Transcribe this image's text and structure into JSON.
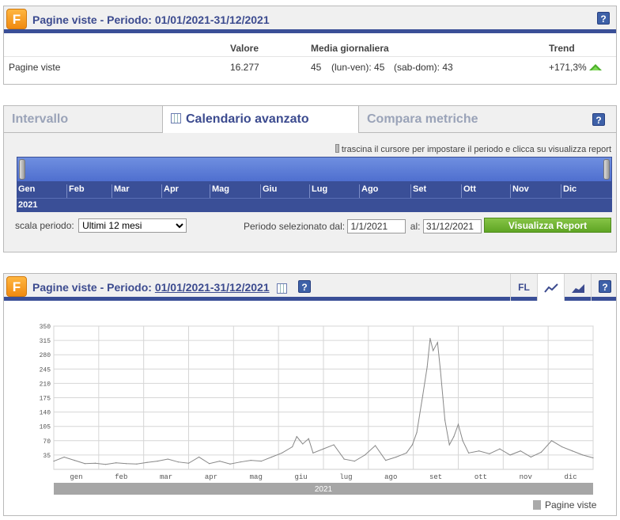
{
  "summary": {
    "logo": "F",
    "title": "Pagine viste - Periodo: 01/01/2021-31/12/2021",
    "help": "?",
    "headers": {
      "valore": "Valore",
      "media": "Media giornaliera",
      "trend": "Trend"
    },
    "row": {
      "label": "Pagine viste",
      "valore": "16.277",
      "media": "45",
      "lunven": "(lun-ven): 45",
      "sabdom": "(sab-dom): 43",
      "trend": "+171,3%"
    }
  },
  "calendar": {
    "tabs": [
      "Intervallo",
      "Calendario avanzato",
      "Compara metriche"
    ],
    "active_tab": 1,
    "help": "?",
    "hint": "trascina il cursore per impostare il periodo e clicca su visualizza report",
    "months": [
      "Gen",
      "Feb",
      "Mar",
      "Apr",
      "Mag",
      "Giu",
      "Lug",
      "Ago",
      "Set",
      "Ott",
      "Nov",
      "Dic"
    ],
    "year": "2021",
    "scale_label": "scala periodo:",
    "scale_value": "Ultimi 12 mesi",
    "period_label": "Periodo selezionato dal:",
    "from": "1/1/2021",
    "to_label": "al:",
    "to": "31/12/2021",
    "button": "Visualizza Report"
  },
  "chart_panel": {
    "logo": "F",
    "title_prefix": "Pagine viste - Periodo:",
    "title_period": "01/01/2021-31/12/2021",
    "help": "?",
    "fl": "FL",
    "accent": "#3a4f97"
  },
  "chart_data": {
    "type": "line",
    "ylim": [
      0,
      350
    ],
    "yticks": [
      35,
      70,
      105,
      140,
      175,
      210,
      245,
      280,
      315,
      350
    ],
    "categories": [
      "gen",
      "feb",
      "mar",
      "apr",
      "mag",
      "giu",
      "lug",
      "ago",
      "set",
      "ott",
      "nov",
      "dic"
    ],
    "year_label": "2021",
    "series": [
      {
        "name": "Pagine viste",
        "color": "#888888",
        "x": [
          1,
          8,
          15,
          22,
          29,
          36,
          43,
          50,
          57,
          64,
          71,
          78,
          85,
          92,
          99,
          106,
          113,
          120,
          127,
          134,
          141,
          148,
          155,
          162,
          165,
          169,
          173,
          176,
          183,
          190,
          197,
          204,
          211,
          218,
          225,
          232,
          239,
          243,
          246,
          250,
          253,
          255,
          257,
          260,
          262,
          265,
          268,
          271,
          274,
          277,
          281,
          288,
          295,
          302,
          309,
          316,
          323,
          330,
          337,
          344,
          351,
          358,
          365
        ],
        "values": [
          20,
          30,
          22,
          14,
          15,
          12,
          16,
          14,
          13,
          17,
          20,
          25,
          18,
          15,
          30,
          14,
          20,
          13,
          18,
          22,
          20,
          30,
          40,
          55,
          80,
          62,
          75,
          40,
          50,
          60,
          25,
          20,
          35,
          58,
          22,
          30,
          40,
          60,
          90,
          180,
          250,
          320,
          290,
          310,
          240,
          120,
          60,
          80,
          110,
          70,
          40,
          45,
          38,
          50,
          35,
          45,
          30,
          42,
          70,
          55,
          45,
          35,
          28
        ]
      }
    ]
  }
}
